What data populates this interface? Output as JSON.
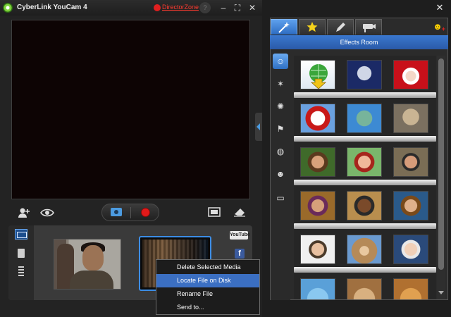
{
  "window": {
    "title": "CyberLink YouCam 4",
    "director_zone": "DirectorZone",
    "minimize": "–",
    "maximize": "⛶",
    "close": "✕",
    "help": "?"
  },
  "library": {
    "share": {
      "youtube": "YouTube",
      "facebook": "f"
    }
  },
  "context_menu": {
    "items": [
      "Delete Selected Media",
      "Locate File on Disk",
      "Rename File",
      "Send to..."
    ],
    "highlighted": "Locate File on Disk"
  },
  "effects_panel": {
    "close": "✕",
    "header": "Effects Room",
    "tabs": [
      {
        "icon": "magic-wand-icon"
      },
      {
        "icon": "emotion-star-icon"
      },
      {
        "icon": "pen-icon"
      },
      {
        "icon": "security-camera-icon"
      }
    ],
    "categories": [
      {
        "icon": "avatar-icon",
        "active": true
      },
      {
        "icon": "magic-wand-icon"
      },
      {
        "icon": "particle-icon"
      },
      {
        "icon": "frame-icon"
      },
      {
        "icon": "mask-icon"
      },
      {
        "icon": "smiley-icon"
      },
      {
        "icon": "filter-icon"
      }
    ],
    "rows": [
      [
        "download",
        "alien",
        "santa"
      ],
      [
        "snowman",
        "statue-of-liberty",
        "sphinx"
      ],
      [
        "woman-avatar-1",
        "woman-avatar-2",
        "man-avatar-1"
      ],
      [
        "man-avatar-2",
        "man-avatar-3",
        "man-avatar-4"
      ],
      [
        "man-avatar-5",
        "teddy-bear",
        "old-man-avatar"
      ],
      [
        "blue-cartoon",
        "dog",
        "puppy"
      ]
    ]
  },
  "colors": {
    "accent": "#3b6fc2",
    "record": "#e21a1a",
    "director_zone": "#ff3b2f"
  }
}
